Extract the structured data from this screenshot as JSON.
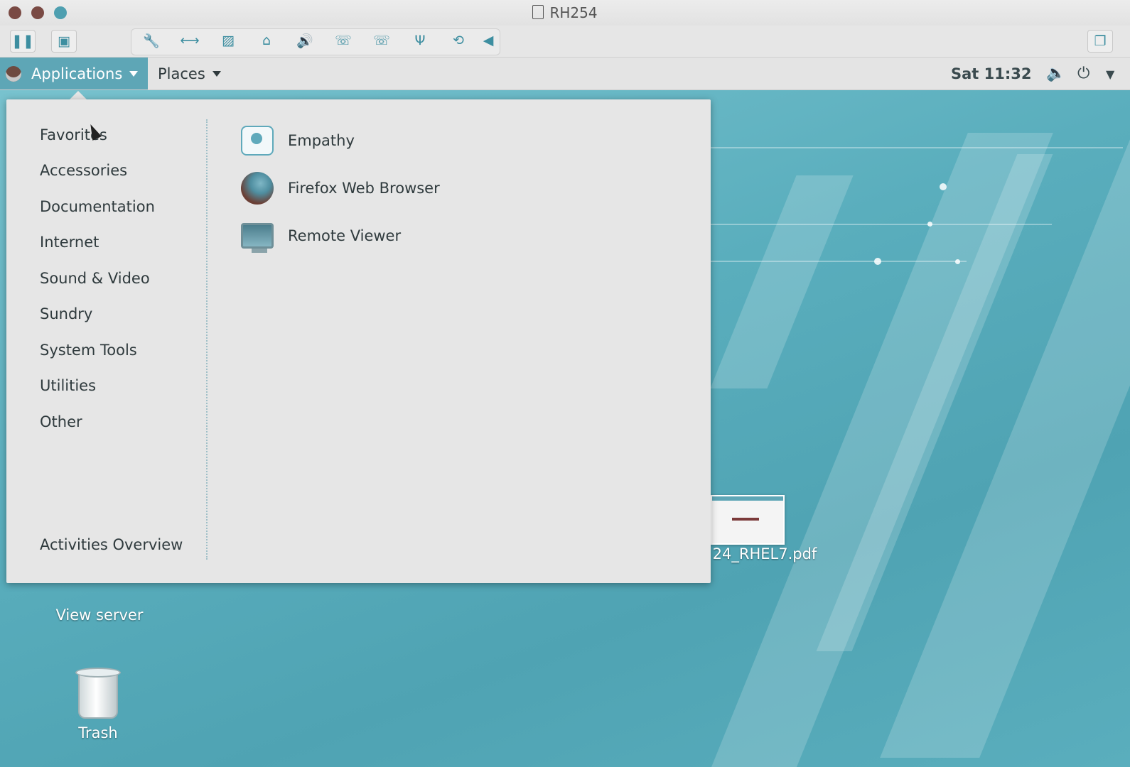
{
  "window": {
    "title": "RH254"
  },
  "host_toolbar": {
    "items": [
      "pause-icon",
      "snapshot-icon",
      "wrench-icon",
      "network-icon",
      "disk-icon",
      "printer-icon",
      "volume-icon",
      "phone-icon",
      "phone-alt-icon",
      "usb-icon",
      "refresh-icon",
      "arrow-left-icon",
      "window-restore-icon"
    ]
  },
  "panel": {
    "applications_label": "Applications",
    "places_label": "Places",
    "clock": "Sat 11:32"
  },
  "menu": {
    "categories": [
      "Favorites",
      "Accessories",
      "Documentation",
      "Internet",
      "Sound & Video",
      "Sundry",
      "System Tools",
      "Utilities",
      "Other"
    ],
    "activities_overview": "Activities Overview",
    "apps": [
      {
        "label": "Empathy",
        "icon": "empathy-icon"
      },
      {
        "label": "Firefox Web Browser",
        "icon": "firefox-icon"
      },
      {
        "label": "Remote Viewer",
        "icon": "remote-viewer-icon"
      }
    ]
  },
  "desktop": {
    "view_server_label": "View server",
    "trash_label": "Trash",
    "pdf_label": "24_RHEL7.pdf"
  },
  "colors": {
    "accent": "#5ea6b6",
    "wallpaper": "#5aaebd",
    "menu_bg": "#e6e6e6"
  }
}
